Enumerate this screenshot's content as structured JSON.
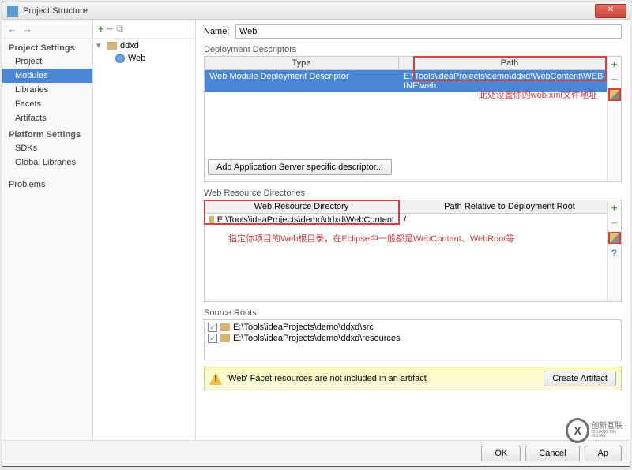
{
  "window": {
    "title": "Project Structure"
  },
  "sidebar": {
    "project_settings_heading": "Project Settings",
    "items_project": [
      "Project",
      "Modules",
      "Libraries",
      "Facets",
      "Artifacts"
    ],
    "platform_settings_heading": "Platform Settings",
    "items_platform": [
      "SDKs",
      "Global Libraries"
    ],
    "problems": "Problems"
  },
  "tree": {
    "module_name": "ddxd",
    "facet_name": "Web"
  },
  "main": {
    "name_label": "Name:",
    "name_value": "Web",
    "deployment_descriptors": {
      "title": "Deployment Descriptors",
      "th_type": "Type",
      "th_path": "Path",
      "row_type": "Web Module Deployment Descriptor",
      "row_path": "E:\\Tools\\ideaProjects\\demo\\ddxd\\WebContent\\WEB-INF\\web.",
      "note": "此处设置你的web.xml文件地址",
      "add_server_btn": "Add Application Server specific descriptor..."
    },
    "web_resource_directories": {
      "title": "Web Resource Directories",
      "th_dir": "Web Resource Directory",
      "th_rel": "Path Relative to Deployment Root",
      "row_dir": "E:\\Tools\\ideaProjects\\demo\\ddxd\\WebContent",
      "row_rel": "/",
      "note": "指定你项目的Web根目录，在Eclipse中一般都是WebContent、WebRoot等"
    },
    "source_roots": {
      "title": "Source Roots",
      "rows": [
        "E:\\Tools\\ideaProjects\\demo\\ddxd\\src",
        "E:\\Tools\\ideaProjects\\demo\\ddxd\\resources"
      ]
    },
    "warning": "'Web' Facet resources are not included in an artifact",
    "create_artifact_btn": "Create Artifact"
  },
  "footer": {
    "ok": "OK",
    "cancel": "Cancel",
    "apply": "Ap"
  },
  "watermark": {
    "logo": "X",
    "text1": "创新互联",
    "text2": "CHUANG XIN HULIAN"
  }
}
